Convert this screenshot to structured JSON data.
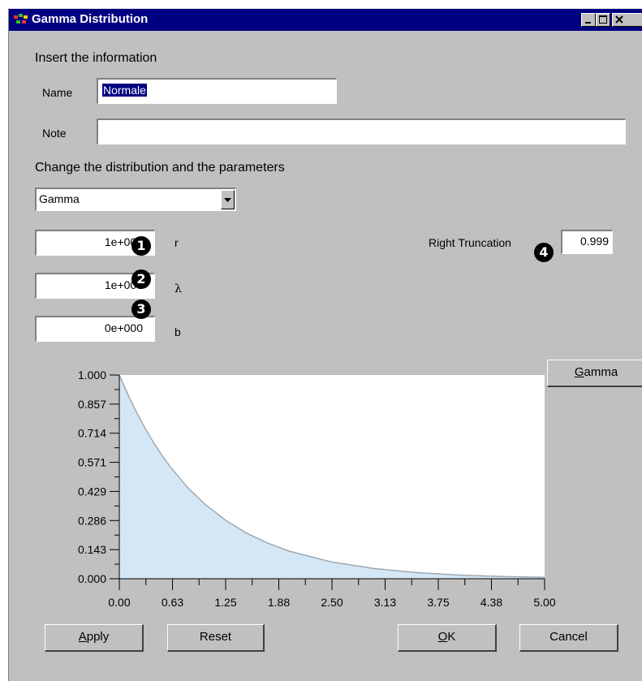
{
  "window": {
    "title": "Gamma Distribution"
  },
  "form": {
    "insert_label": "Insert the information",
    "name_label": "Name",
    "name_value": "Normale",
    "note_label": "Note",
    "note_value": "",
    "change_label": "Change the distribution and the parameters",
    "distribution": "Gamma",
    "params": [
      {
        "value": "1e+000",
        "label": "r"
      },
      {
        "value": "1e+000",
        "label": "λ"
      },
      {
        "value": "0e+000",
        "label": "b"
      }
    ],
    "right_truncation_label": "Right Truncation",
    "right_truncation_value": "0.999",
    "callouts": [
      "1",
      "2",
      "3",
      "4"
    ]
  },
  "chart_data": {
    "type": "area",
    "x": [
      0,
      0.1,
      0.2,
      0.3,
      0.4,
      0.5,
      0.6,
      0.8,
      1.0,
      1.25,
      1.5,
      1.75,
      2.0,
      2.5,
      3.0,
      3.5,
      4.0,
      4.5,
      5.0
    ],
    "y": [
      1.0,
      0.905,
      0.819,
      0.741,
      0.67,
      0.607,
      0.549,
      0.449,
      0.368,
      0.287,
      0.223,
      0.174,
      0.135,
      0.082,
      0.05,
      0.03,
      0.018,
      0.011,
      0.007
    ],
    "xlim": [
      0,
      5.0
    ],
    "ylim": [
      0,
      1.0
    ],
    "xticks": [
      "0.00",
      "0.63",
      "1.25",
      "1.88",
      "2.50",
      "3.13",
      "3.75",
      "4.38",
      "5.00"
    ],
    "yticks": [
      "1.000",
      "0.857",
      "0.714",
      "0.571",
      "0.429",
      "0.286",
      "0.143",
      "0.000"
    ],
    "fill_color": "#d3e7f7",
    "line_color": "#a0a8b0"
  },
  "buttons": {
    "gamma": "Gamma",
    "apply": "Apply",
    "reset": "Reset",
    "ok": "OK",
    "cancel": "Cancel"
  }
}
